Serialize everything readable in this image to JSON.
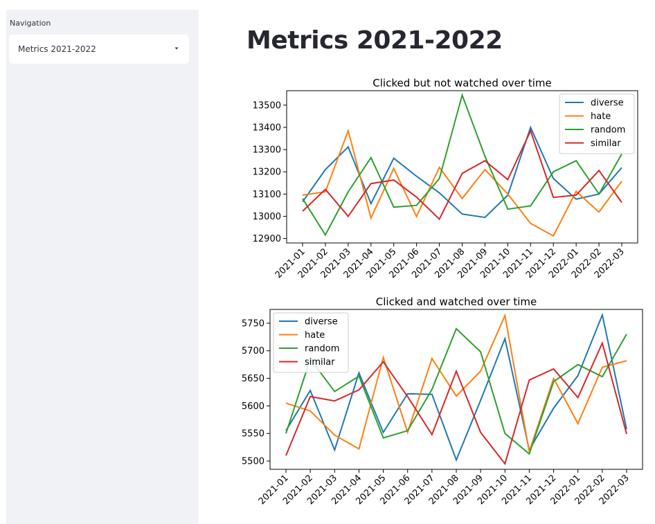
{
  "sidebar": {
    "nav_label": "Navigation",
    "select_value": "Metrics 2021-2022"
  },
  "page": {
    "title": "Metrics 2021-2022"
  },
  "chart_data": [
    {
      "type": "line",
      "title": "Clicked but not watched over time",
      "x": [
        "2021-01",
        "2021-02",
        "2021-03",
        "2021-04",
        "2021-05",
        "2021-06",
        "2021-07",
        "2021-08",
        "2021-09",
        "2021-10",
        "2021-11",
        "2021-12",
        "2022-01",
        "2022-02",
        "2022-03"
      ],
      "yticks": [
        12900,
        13000,
        13100,
        13200,
        13300,
        13400,
        13500
      ],
      "ylim": [
        12880,
        13565
      ],
      "legend": "top-right",
      "series": [
        {
          "name": "diverse",
          "color": "#1f77b4",
          "values": [
            13065,
            13210,
            13312,
            13057,
            13261,
            13180,
            13105,
            13010,
            12995,
            13095,
            13400,
            13170,
            13077,
            13100,
            13219
          ]
        },
        {
          "name": "hate",
          "color": "#ff7f0e",
          "values": [
            13095,
            13110,
            13385,
            12992,
            13215,
            12999,
            13220,
            13080,
            13210,
            13100,
            12968,
            12912,
            13112,
            13019,
            13158
          ]
        },
        {
          "name": "random",
          "color": "#2ca02c",
          "values": [
            13080,
            12916,
            13110,
            13264,
            13041,
            13049,
            13170,
            13545,
            13270,
            13032,
            13047,
            13200,
            13250,
            13100,
            13280
          ]
        },
        {
          "name": "similar",
          "color": "#d62728",
          "values": [
            13023,
            13121,
            13000,
            13147,
            13163,
            13086,
            12987,
            13193,
            13250,
            13165,
            13384,
            13085,
            13095,
            13206,
            13062
          ]
        }
      ]
    },
    {
      "type": "line",
      "title": "Clicked and watched over time",
      "x": [
        "2021-01",
        "2021-02",
        "2021-03",
        "2021-04",
        "2021-05",
        "2021-06",
        "2021-07",
        "2021-08",
        "2021-09",
        "2021-10",
        "2021-11",
        "2021-12",
        "2022-01",
        "2022-02",
        "2022-03"
      ],
      "yticks": [
        5500,
        5550,
        5600,
        5650,
        5700,
        5750
      ],
      "ylim": [
        5485,
        5775
      ],
      "legend": "top-left",
      "series": [
        {
          "name": "diverse",
          "color": "#1f77b4",
          "values": [
            5555,
            5628,
            5520,
            5660,
            5552,
            5622,
            5621,
            5502,
            5610,
            5722,
            5520,
            5596,
            5655,
            5765,
            5558
          ]
        },
        {
          "name": "hate",
          "color": "#ff7f0e",
          "values": [
            5605,
            5591,
            5547,
            5522,
            5688,
            5552,
            5686,
            5618,
            5663,
            5764,
            5517,
            5650,
            5568,
            5670,
            5682
          ]
        },
        {
          "name": "random",
          "color": "#2ca02c",
          "values": [
            5550,
            5685,
            5626,
            5654,
            5542,
            5555,
            5630,
            5740,
            5698,
            5550,
            5513,
            5644,
            5675,
            5653,
            5730
          ]
        },
        {
          "name": "similar",
          "color": "#d62728",
          "values": [
            5510,
            5617,
            5609,
            5629,
            5680,
            5617,
            5548,
            5663,
            5552,
            5495,
            5647,
            5667,
            5615,
            5714,
            5549
          ]
        }
      ]
    }
  ]
}
